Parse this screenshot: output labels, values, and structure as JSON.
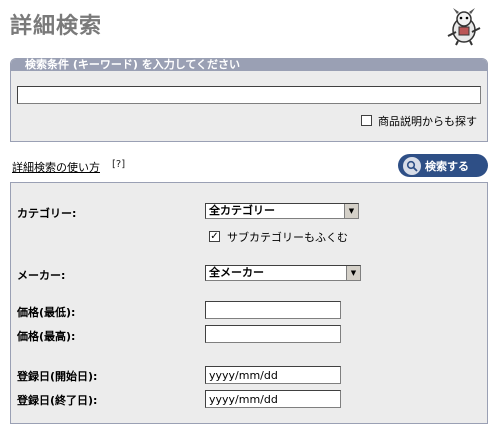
{
  "page": {
    "title": "詳細検索"
  },
  "keyword": {
    "header": "検索条件 (キーワード) を入力してください",
    "value": "",
    "include_description_label": "商品説明からも探す",
    "include_description_checked": false
  },
  "help": {
    "link_label": "詳細検索の使い方",
    "mark": "[?]"
  },
  "search_button": {
    "label": "検索する",
    "icon": "search-icon"
  },
  "filters": {
    "category_label": "カテゴリー:",
    "category_value": "全カテゴリー",
    "subcategory_label": "サブカテゴリーもふくむ",
    "subcategory_checked": true,
    "maker_label": "メーカー:",
    "maker_value": "全メーカー",
    "price_min_label": "価格(最低):",
    "price_min_value": "",
    "price_max_label": "価格(最高):",
    "price_max_value": "",
    "date_start_label": "登録日(開始日):",
    "date_start_value": "yyyy/mm/dd",
    "date_end_label": "登録日(終了日):",
    "date_end_value": "yyyy/mm/dd"
  },
  "colors": {
    "panel_border": "#9aa0b4",
    "panel_bg": "#ececec",
    "button_bg": "#2e4f86"
  }
}
